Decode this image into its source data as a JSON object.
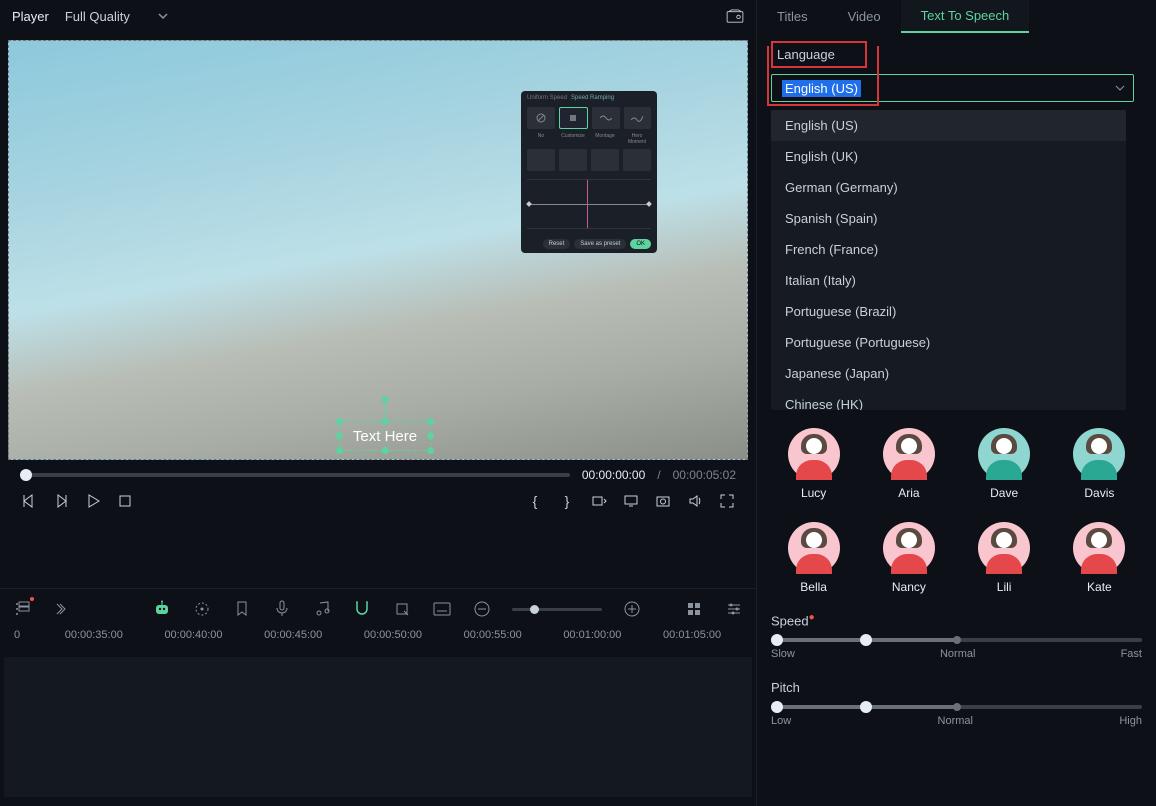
{
  "topbar": {
    "player": "Player",
    "quality": "Full Quality"
  },
  "preview": {
    "overlay": {
      "tabs": [
        "Uniform Speed",
        "Speed Ramping"
      ],
      "opts": [
        "No",
        "Customize",
        "Montage",
        "Hero Moment"
      ],
      "btns": {
        "reset": "Reset",
        "save": "Save as preset",
        "ok": "OK"
      }
    },
    "textbox": "Text Here"
  },
  "transport": {
    "current": "00:00:00:00",
    "separator": "/",
    "total": "00:00:05:02"
  },
  "timeline": {
    "labels": [
      "0",
      "00:00:35:00",
      "00:00:40:00",
      "00:00:45:00",
      "00:00:50:00",
      "00:00:55:00",
      "00:01:00:00",
      "00:01:05:00"
    ]
  },
  "rightTabs": [
    "Titles",
    "Video",
    "Text To Speech"
  ],
  "language": {
    "label": "Language",
    "selected": "English (US)",
    "options": [
      "English (US)",
      "English (UK)",
      "German (Germany)",
      "Spanish (Spain)",
      "French (France)",
      "Italian (Italy)",
      "Portuguese (Brazil)",
      "Portuguese (Portuguese)",
      "Japanese (Japan)",
      "Chinese (HK)"
    ]
  },
  "voices": [
    {
      "name": "Lucy",
      "bg": "pink",
      "body": "red"
    },
    {
      "name": "Aria",
      "bg": "pink",
      "body": "red"
    },
    {
      "name": "Dave",
      "bg": "teal",
      "body": "teal2"
    },
    {
      "name": "Davis",
      "bg": "teal",
      "body": "teal2"
    },
    {
      "name": "Bella",
      "bg": "pink",
      "body": "red"
    },
    {
      "name": "Nancy",
      "bg": "pink",
      "body": "red"
    },
    {
      "name": "Lili",
      "bg": "pink",
      "body": "red"
    },
    {
      "name": "Kate",
      "bg": "pink",
      "body": "red"
    }
  ],
  "speed": {
    "label": "Speed",
    "min": "Slow",
    "mid": "Normal",
    "max": "Fast"
  },
  "pitch": {
    "label": "Pitch",
    "min": "Low",
    "mid": "Normal",
    "max": "High"
  }
}
